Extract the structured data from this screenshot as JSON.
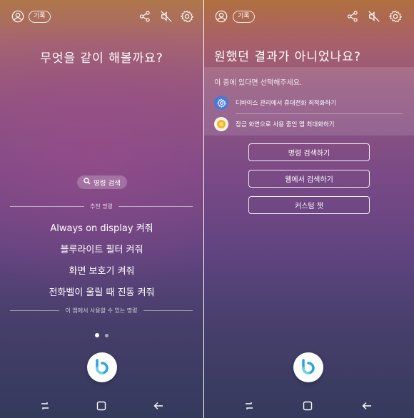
{
  "left_screen": {
    "top_bar": {
      "profile_icon": "person-circle-icon",
      "history_label": "기록",
      "share_icon": "share-icon",
      "mute_icon": "speaker-mute-icon",
      "settings_icon": "gear-icon"
    },
    "question": "무엇을 같이 해볼까요?",
    "search_chip_label": "명령 검색",
    "recommended_header": "추천 명령",
    "suggestions": [
      "Always on display 켜줘",
      "블루라이트 필터 켜줘",
      "화면 보호기 켜줘",
      "전화벨이 울릴 때 진동 켜줘"
    ],
    "footer_header": "이 앱에서 사용할 수 있는 명령",
    "page_dots": {
      "count": 2,
      "active_index": 0
    },
    "bixby_button_icon": "bixby-b-icon"
  },
  "right_screen": {
    "top_bar": {
      "profile_icon": "person-circle-icon",
      "history_label": "기록",
      "share_icon": "share-icon",
      "mute_icon": "speaker-mute-icon",
      "settings_icon": "gear-icon"
    },
    "question": "원했던 결과가 아니었나요?",
    "list_header": "이 중에 있다면 선택해주세요.",
    "options": [
      {
        "label": "디바이스 관리에서 휴대전화 최적화하기",
        "icon": "device-care-icon",
        "color": "#4a78d6"
      },
      {
        "label": "잠금 화면으로 사용 중인 앱 최대화하기",
        "icon": "lock-screen-app-icon",
        "color": "#f2b81c"
      }
    ],
    "buttons": [
      "명령 검색하기",
      "웹에서 검색하기",
      "커스텀 챗"
    ],
    "bixby_button_icon": "bixby-b-icon"
  },
  "nav_bar": {
    "recent_icon": "recent-apps-icon",
    "home_icon": "home-square-icon",
    "back_icon": "back-arrow-icon"
  },
  "colors": {
    "bixby_blue": "#2aa3e0",
    "bixby_teal": "#6fd0e6"
  }
}
